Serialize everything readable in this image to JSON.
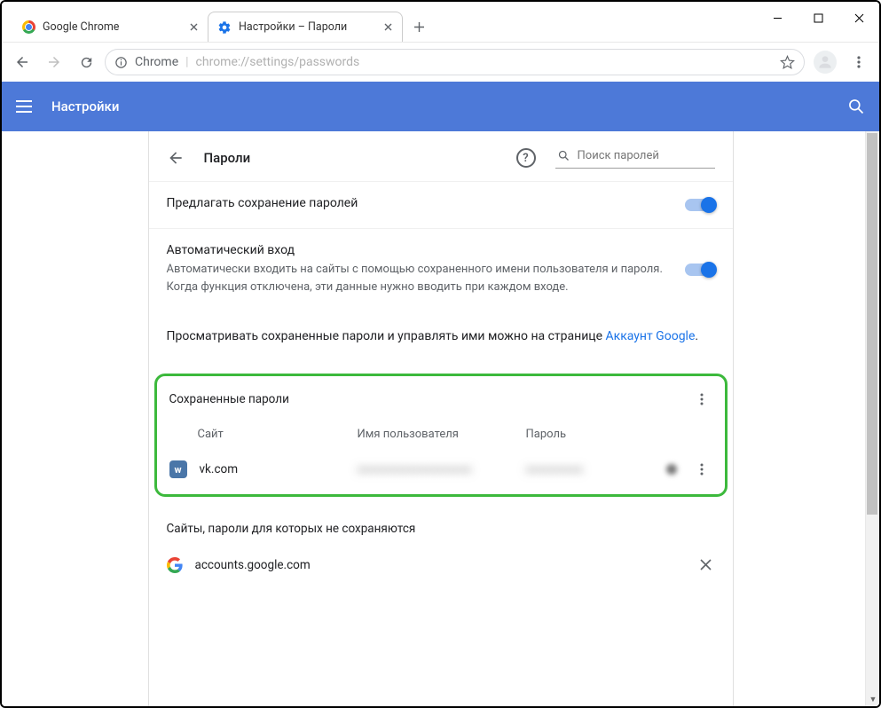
{
  "tabs": [
    {
      "label": "Google Chrome"
    },
    {
      "label": "Настройки – Пароли"
    }
  ],
  "address": {
    "host": "Chrome",
    "path": "chrome://settings/passwords"
  },
  "appbar": {
    "title": "Настройки"
  },
  "page": {
    "back_title": "Пароли",
    "search_placeholder": "Поиск паролей",
    "offer_save": {
      "title": "Предлагать сохранение паролей"
    },
    "auto_signin": {
      "title": "Автоматический вход",
      "desc": "Автоматически входить на сайты с помощью сохраненного имени пользователя и пароля. Когда функция отключена, эти данные нужно вводить при каждом входе."
    },
    "manage_text": "Просматривать сохраненные пароли и управлять ими можно на странице ",
    "manage_link": "Аккаунт Google",
    "saved": {
      "header": "Сохраненные пароли",
      "col_site": "Сайт",
      "col_user": "Имя пользователя",
      "col_pass": "Пароль",
      "rows": [
        {
          "site": "vk.com",
          "user": "xxxxxxxxxxxxxxxxxxxx",
          "pass": "xxxxxxxxxx"
        }
      ]
    },
    "never": {
      "header": "Сайты, пароли для которых не сохраняются",
      "rows": [
        {
          "site": "accounts.google.com"
        }
      ]
    }
  }
}
